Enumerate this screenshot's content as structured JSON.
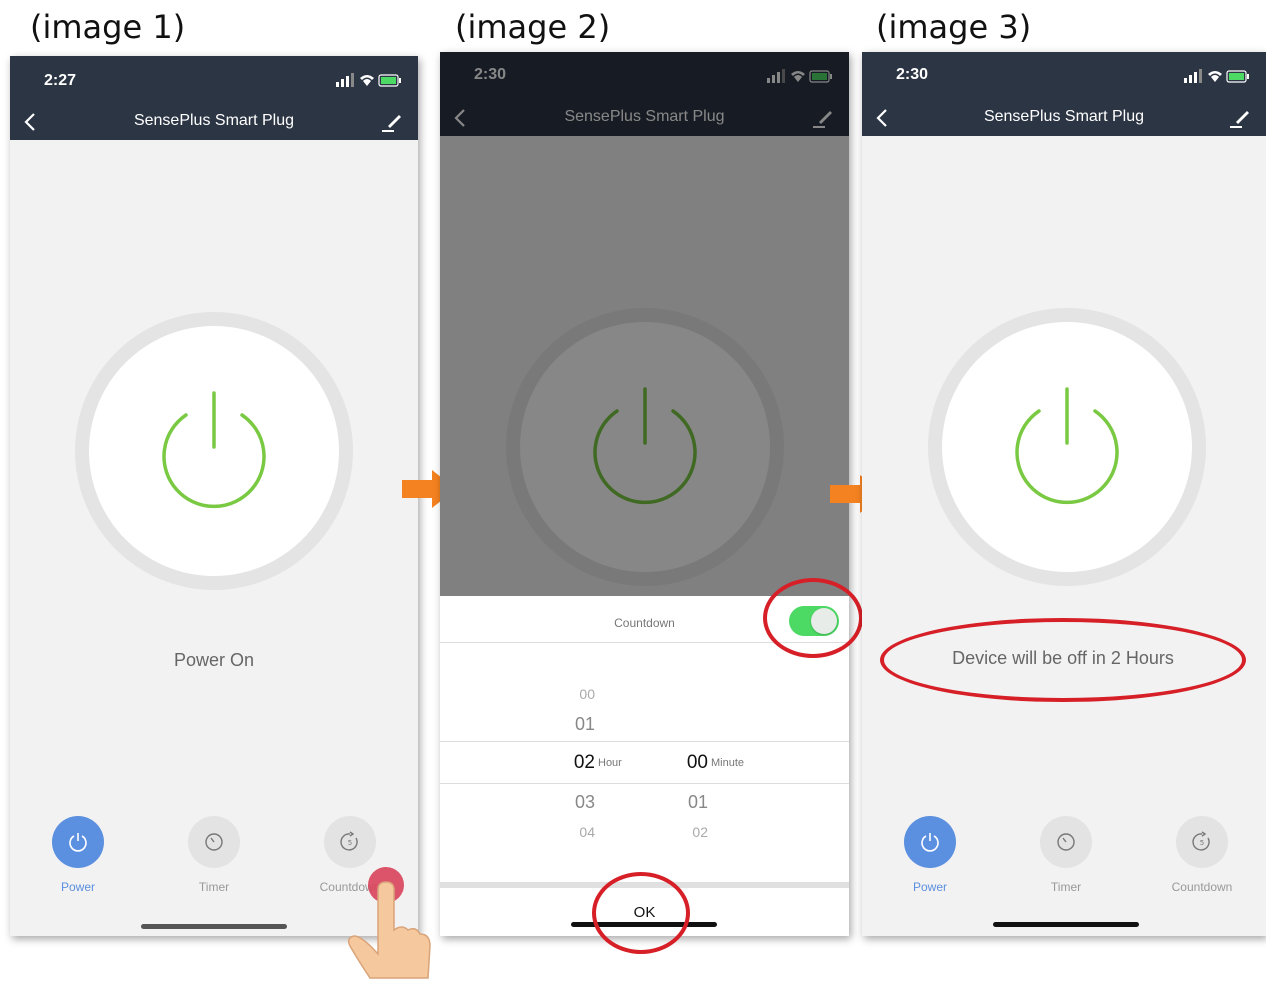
{
  "captions": [
    "(image 1)",
    "(image 2)",
    "(image 3)"
  ],
  "screen1": {
    "time": "2:27",
    "title": "SensePlus Smart Plug",
    "status": "Power On",
    "tabs": [
      "Power",
      "Timer",
      "Countdown"
    ]
  },
  "screen2": {
    "time": "2:30",
    "title": "SensePlus Smart Plug",
    "sheet_title": "Countdown",
    "toggle_on": true,
    "hours": [
      "00",
      "01",
      "02",
      "03",
      "04"
    ],
    "selected_hour": "02",
    "hour_unit": "Hour",
    "minutes": [
      "00",
      "01",
      "02"
    ],
    "selected_minute": "00",
    "minute_unit": "Minute",
    "ok_label": "OK"
  },
  "screen3": {
    "time": "2:30",
    "title": "SensePlus Smart Plug",
    "status": "Device will be off in 2 Hours",
    "tabs": [
      "Power",
      "Timer",
      "Countdown"
    ]
  },
  "colors": {
    "header": "#2c3544",
    "accent": "#5b8fe0",
    "power_green": "#7ac943",
    "toggle_green": "#4cd964",
    "annotation_red": "#d61f26",
    "arrow_orange": "#f58220"
  }
}
